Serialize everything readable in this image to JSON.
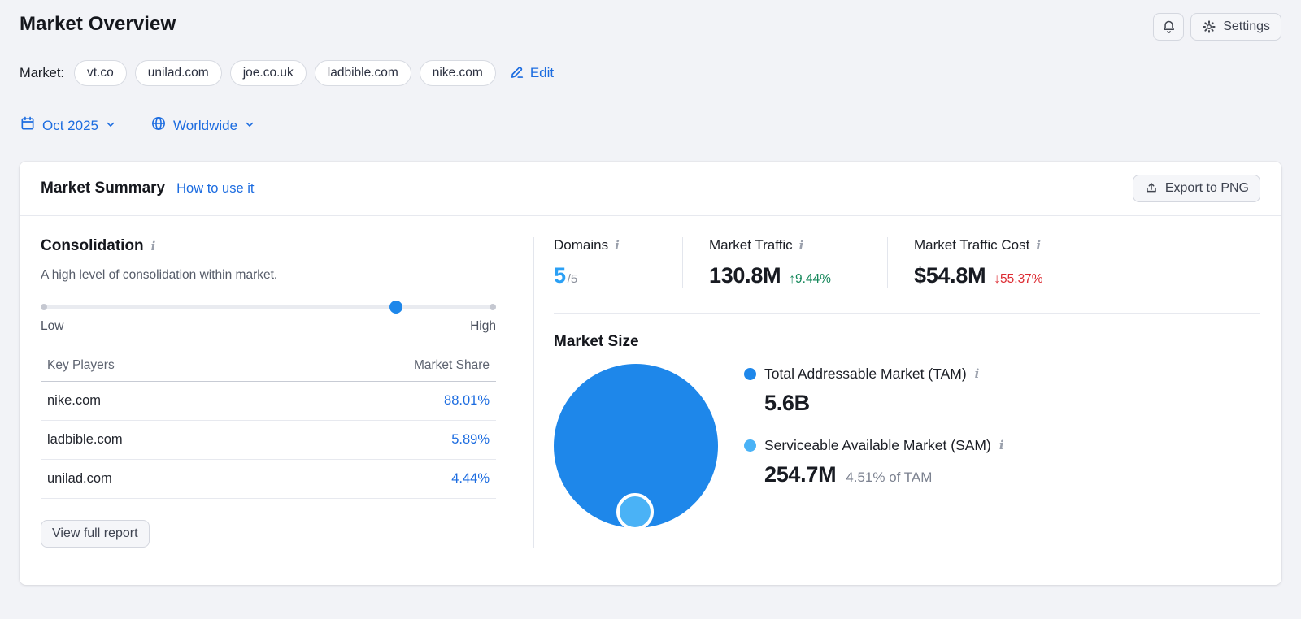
{
  "page": {
    "title": "Market Overview",
    "market_label": "Market:",
    "market_domains": [
      "vt.co",
      "unilad.com",
      "joe.co.uk",
      "ladbible.com",
      "nike.com"
    ],
    "edit_label": "Edit",
    "date_filter": "Oct 2025",
    "region_filter": "Worldwide"
  },
  "header_actions": {
    "settings_label": "Settings"
  },
  "card": {
    "title": "Market Summary",
    "help_link": "How to use it",
    "export_label": "Export to PNG"
  },
  "consolidation": {
    "title": "Consolidation",
    "description": "A high level of consolidation within market.",
    "level_percent": 78,
    "low_label": "Low",
    "high_label": "High",
    "table": {
      "headers": {
        "players": "Key Players",
        "share": "Market Share"
      },
      "rows": [
        {
          "domain": "nike.com",
          "share": "88.01%"
        },
        {
          "domain": "ladbible.com",
          "share": "5.89%"
        },
        {
          "domain": "unilad.com",
          "share": "4.44%"
        }
      ]
    },
    "view_report_label": "View full report"
  },
  "stats": {
    "domains": {
      "label": "Domains",
      "value": "5",
      "total": "/5"
    },
    "traffic": {
      "label": "Market Traffic",
      "value": "130.8M",
      "change": "↑9.44%",
      "trend": "up"
    },
    "traffic_cost": {
      "label": "Market Traffic Cost",
      "value": "$54.8M",
      "change": "↓55.37%",
      "trend": "down"
    }
  },
  "market_size": {
    "title": "Market Size",
    "tam": {
      "label": "Total Addressable Market (TAM)",
      "value": "5.6B"
    },
    "sam": {
      "label": "Serviceable Available Market (SAM)",
      "value": "254.7M",
      "note": "4.51% of TAM"
    }
  },
  "chart_data": {
    "type": "bubble",
    "title": "Market Size",
    "legend_position": "right",
    "series": [
      {
        "name": "Total Addressable Market (TAM)",
        "value_display": "5.6B",
        "value": 5600000000,
        "color": "#1e87ea"
      },
      {
        "name": "Serviceable Available Market (SAM)",
        "value_display": "254.7M",
        "value": 254700000,
        "percent_of_tam": 4.51,
        "color": "#4ab2f6"
      }
    ]
  },
  "colors": {
    "accent_blue": "#1c6ce0",
    "bright_blue": "#2ba0f5",
    "tam_blue": "#1e87ea",
    "sam_blue": "#4ab2f6",
    "positive_green": "#14875a",
    "negative_red": "#dd2c33"
  },
  "icons": {
    "notifications": "bell",
    "settings": "gear",
    "edit": "pencil",
    "date": "calendar",
    "region": "globe",
    "dropdown": "chevron-down",
    "export": "upload-arrow",
    "info": "italic-i"
  }
}
